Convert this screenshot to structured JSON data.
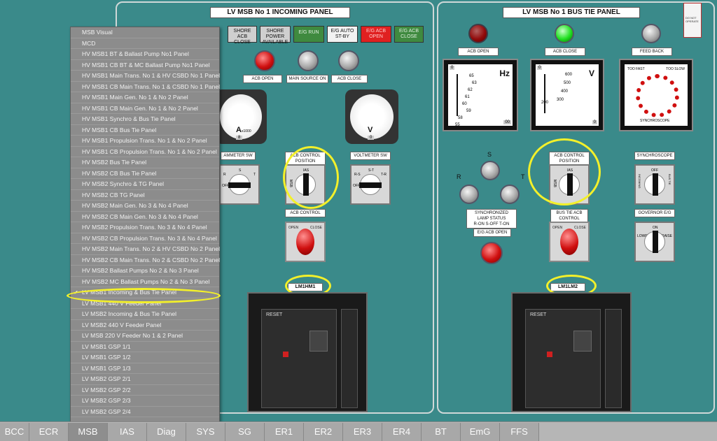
{
  "left_panel": {
    "title": "LV MSB No 1 INCOMING PANEL",
    "status_buttons": [
      {
        "label": "SHORE ACB CLOSE",
        "state": "grey"
      },
      {
        "label": "SHORE POWER AVAILABLE",
        "state": "grey"
      },
      {
        "label": "E/G RUN",
        "state": "green"
      },
      {
        "label": "E/G AUTO ST-BY",
        "state": "white"
      },
      {
        "label": "E/G ACB OPEN",
        "state": "red"
      },
      {
        "label": "E/G ACB CLOSE",
        "state": "green"
      }
    ],
    "lamps": [
      {
        "label": "ACB OPEN",
        "color": "red"
      },
      {
        "label": "MAIN SOURCE ON",
        "color": "grey"
      },
      {
        "label": "ACB CLOSE",
        "color": "grey"
      }
    ],
    "ammeter": {
      "unit": "A",
      "multiplier": "x1000",
      "reading": "8"
    },
    "voltmeter": {
      "unit": "V",
      "reading": "0"
    },
    "ammeter_sw_label": "AMMETER SW",
    "ammeter_sw_positions": {
      "left": "R",
      "center": "S",
      "right": "T",
      "off": "OFF"
    },
    "acb_control_position_label": "ACB CONTROL POSITION",
    "acb_control_position_labels": {
      "top": "IAS",
      "left": "MSB"
    },
    "voltmeter_sw_label": "VOLTMETER SW",
    "voltmeter_sw_positions": {
      "left": "R-S",
      "center": "S-T",
      "right": "T-R",
      "off": "OFF"
    },
    "acb_control_label": "ACB CONTROL",
    "open_label": "OPEN",
    "close_label": "CLOSE",
    "breaker_tag": "LM1HM1",
    "reset_label": "RESET"
  },
  "right_panel": {
    "title": "LV MSB No 1 BUS TIE PANEL",
    "lamps": [
      {
        "label": "ACB OPEN",
        "color": "red-dim"
      },
      {
        "label": "ACB CLOSE",
        "color": "green"
      },
      {
        "label": "FEED BACK",
        "color": "grey"
      }
    ],
    "hz_meter": {
      "unit": "Hz",
      "ticks": [
        "65",
        "63",
        "62",
        "61",
        "60",
        "59",
        "58",
        "57",
        "55"
      ],
      "reading": "0",
      "reading2": "00"
    },
    "v_meter": {
      "unit": "V",
      "ticks": [
        "600",
        "500",
        "400",
        "300",
        "200"
      ],
      "reading": "0",
      "reading2": "0"
    },
    "synchroscope": {
      "label": "SYNCHROSCOPE",
      "too_fast": "TOO FAST",
      "too_slow": "TOO SLOW"
    },
    "sync_lamps": {
      "labels": [
        "S",
        "R",
        "T"
      ],
      "status": "SYNCHRONIZED LAMP STATUS",
      "status_line2": "R-ON  S-OFF  T-ON"
    },
    "acb_control_position_label": "ACB CONTROL POSITION",
    "acb_control_position_labels": {
      "top": "IAS",
      "left": "MSB"
    },
    "synchroscope_sw_label": "SYNCHROSCOPE",
    "synchroscope_sw_positions": {
      "top": "OFF",
      "left": "INCOMING",
      "right": "BUS TIE"
    },
    "bus_tie_acb_control_label": "BUS TIE ACB CONTROL",
    "eg_acb_open_label": "E/G ACB OPEN",
    "governor_label": "GOVERNOR E/G",
    "governor_positions": {
      "left": "LOWER",
      "center": "ON",
      "right": "RAISE"
    },
    "open_label": "OPEN",
    "close_label": "CLOSE",
    "breaker_tag": "LM1LM2",
    "reset_label": "RESET",
    "warning_tag": "DO NOT OPERATE"
  },
  "menu": {
    "items": [
      {
        "label": "MSB Visual",
        "checked": false
      },
      {
        "label": "MCD",
        "checked": false
      },
      {
        "label": "HV MSB1 BT & Ballast Pump No1 Panel",
        "checked": false
      },
      {
        "label": "HV MSB1 CB BT & MC Ballast Pump No1 Panel",
        "checked": false
      },
      {
        "label": "HV MSB1 Main Trans. No 1 & HV CSBD No 1 Panel",
        "checked": false
      },
      {
        "label": "HV MSB1 CB Main Trans. No 1 & CSBD No 1 Panel",
        "checked": false
      },
      {
        "label": "HV MSB1 Main Gen. No 1 & No 2 Panel",
        "checked": false
      },
      {
        "label": "HV MSB1 CB Main Gen. No 1 & No 2 Panel",
        "checked": false
      },
      {
        "label": "HV MSB1 Synchro & Bus Tie Panel",
        "checked": false
      },
      {
        "label": "HV MSB1 CB Bus Tie Panel",
        "checked": false
      },
      {
        "label": "HV MSB1 Propulsion Trans. No 1 & No 2 Panel",
        "checked": false
      },
      {
        "label": "HV MSB1 CB Propulsion Trans. No 1 & No 2 Panel",
        "checked": false
      },
      {
        "label": "HV MSB2 Bus Tie Panel",
        "checked": false
      },
      {
        "label": "HV MSB2 CB Bus Tie Panel",
        "checked": false
      },
      {
        "label": "HV MSB2 Synchro & TG Panel",
        "checked": false
      },
      {
        "label": "HV MSB2 CB TG Panel",
        "checked": false
      },
      {
        "label": "HV MSB2 Main Gen. No 3 & No 4 Panel",
        "checked": false
      },
      {
        "label": "HV MSB2 CB Main Gen. No 3 & No 4 Panel",
        "checked": false
      },
      {
        "label": "HV MSB2 Propulsion Trans. No 3 & No 4 Panel",
        "checked": false
      },
      {
        "label": "HV MSB2 CB Propulsion Trans. No 3 & No 4 Panel",
        "checked": false
      },
      {
        "label": "HV MSB2 Main Trans. No 2 & HV CSBD No 2 Panel",
        "checked": false
      },
      {
        "label": "HV MSB2 CB Main Trans. No 2 & CSBD No 2 Panel",
        "checked": false
      },
      {
        "label": "HV MSB2 Ballast Pumps No 2 & No 3 Panel",
        "checked": false
      },
      {
        "label": "HV MSB2 MC Ballast Pumps No 2 & No 3 Panel",
        "checked": false
      },
      {
        "label": "LV MSB1 Incoming & Bus Tie Panel",
        "checked": true
      },
      {
        "label": "LV MSB1 440 V Feeder Panel",
        "checked": false
      },
      {
        "label": "LV MSB2 Incoming & Bus Tie Panel",
        "checked": false
      },
      {
        "label": "LV MSB2 440 V Feeder Panel",
        "checked": false
      },
      {
        "label": "LV MSB 220 V Feeder  No 1 & 2 Panel",
        "checked": false
      },
      {
        "label": "LV MSB1 GSP 1/1",
        "checked": false
      },
      {
        "label": "LV MSB1 GSP 1/2",
        "checked": false
      },
      {
        "label": "LV MSB1 GSP 1/3",
        "checked": false
      },
      {
        "label": "LV MSB2 GSP 2/1",
        "checked": false
      },
      {
        "label": "LV MSB2 GSP 2/2",
        "checked": false
      },
      {
        "label": "LV MSB2 GSP 2/3",
        "checked": false
      },
      {
        "label": "LV MSB2 GSP 2/4",
        "checked": false
      }
    ]
  },
  "taskbar": {
    "tabs": [
      {
        "label": "BCC",
        "active": false
      },
      {
        "label": "ECR",
        "active": false
      },
      {
        "label": "MSB",
        "active": true
      },
      {
        "label": "IAS",
        "active": false
      },
      {
        "label": "Diag",
        "active": false
      },
      {
        "label": "SYS",
        "active": false
      },
      {
        "label": "SG",
        "active": false
      },
      {
        "label": "ER1",
        "active": false
      },
      {
        "label": "ER2",
        "active": false
      },
      {
        "label": "ER3",
        "active": false
      },
      {
        "label": "ER4",
        "active": false
      },
      {
        "label": "BT",
        "active": false
      },
      {
        "label": "EmG",
        "active": false
      },
      {
        "label": "FFS",
        "active": false
      }
    ]
  },
  "colors": {
    "background": "#3a8a8a",
    "highlight": "#f3f02a",
    "menu_bg": "#8c8c8c"
  }
}
